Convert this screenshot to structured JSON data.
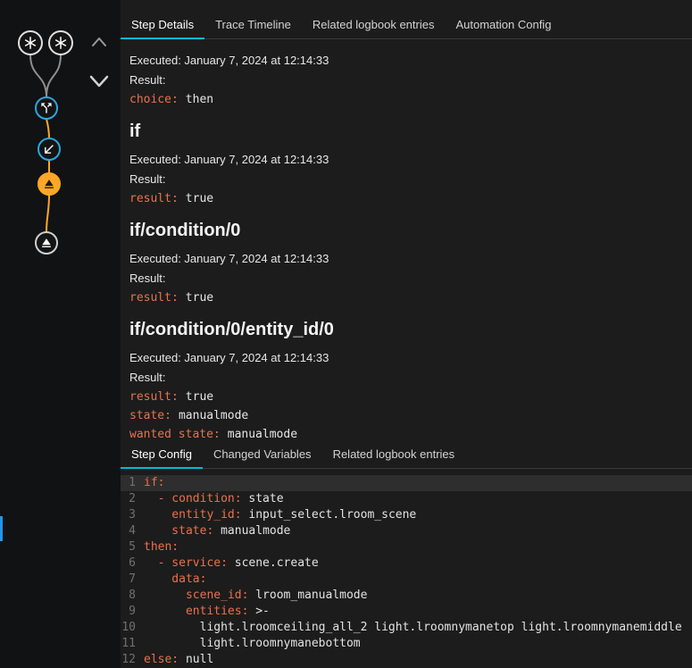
{
  "colors": {
    "tab_accent": "#00bcd4",
    "yaml_key": "#e8724d",
    "node_blue": "#2ba7e0",
    "node_amber": "#ffa726",
    "rail_indicator_blue": "#2196f3"
  },
  "top_tabs": {
    "items": [
      {
        "label": "Step Details",
        "active": true
      },
      {
        "label": "Trace Timeline",
        "active": false
      },
      {
        "label": "Related logbook entries",
        "active": false
      },
      {
        "label": "Automation Config",
        "active": false
      }
    ]
  },
  "sections": [
    {
      "executed": "Executed: January 7, 2024 at 12:14:33",
      "result_label": "Result:",
      "mono": [
        {
          "key": "choice:",
          "value": "then"
        }
      ]
    },
    {
      "heading": "if",
      "executed": "Executed: January 7, 2024 at 12:14:33",
      "result_label": "Result:",
      "mono": [
        {
          "key": "result:",
          "value": "true"
        }
      ]
    },
    {
      "heading": "if/condition/0",
      "executed": "Executed: January 7, 2024 at 12:14:33",
      "result_label": "Result:",
      "mono": [
        {
          "key": "result:",
          "value": "true"
        }
      ]
    },
    {
      "heading": "if/condition/0/entity_id/0",
      "executed": "Executed: January 7, 2024 at 12:14:33",
      "result_label": "Result:",
      "mono": [
        {
          "key": "result:",
          "value": "true"
        },
        {
          "key": "state:",
          "value": "manualmode"
        },
        {
          "key": "wanted_state:",
          "value": "manualmode"
        }
      ]
    }
  ],
  "bottom_tabs": {
    "items": [
      {
        "label": "Step Config",
        "active": true
      },
      {
        "label": "Changed Variables",
        "active": false
      },
      {
        "label": "Related logbook entries",
        "active": false
      }
    ]
  },
  "code": {
    "lines": [
      {
        "num": "1",
        "highlight": true,
        "segments": [
          {
            "t": "if:",
            "c": "k"
          }
        ]
      },
      {
        "num": "2",
        "highlight": false,
        "segments": [
          {
            "t": "  - condition:",
            "c": "k"
          },
          {
            "t": " state",
            "c": "v"
          }
        ]
      },
      {
        "num": "3",
        "highlight": false,
        "segments": [
          {
            "t": "    entity_id:",
            "c": "k"
          },
          {
            "t": " input_select.lroom_scene",
            "c": "v"
          }
        ]
      },
      {
        "num": "4",
        "highlight": false,
        "segments": [
          {
            "t": "    state:",
            "c": "k"
          },
          {
            "t": " manualmode",
            "c": "v"
          }
        ]
      },
      {
        "num": "5",
        "highlight": false,
        "segments": [
          {
            "t": "then:",
            "c": "k"
          }
        ]
      },
      {
        "num": "6",
        "highlight": false,
        "segments": [
          {
            "t": "  - service:",
            "c": "k"
          },
          {
            "t": " scene.create",
            "c": "v"
          }
        ]
      },
      {
        "num": "7",
        "highlight": false,
        "segments": [
          {
            "t": "    data:",
            "c": "k"
          }
        ]
      },
      {
        "num": "8",
        "highlight": false,
        "segments": [
          {
            "t": "      scene_id:",
            "c": "k"
          },
          {
            "t": " lroom_manualmode",
            "c": "v"
          }
        ]
      },
      {
        "num": "9",
        "highlight": false,
        "segments": [
          {
            "t": "      entities:",
            "c": "k"
          },
          {
            "t": " >-",
            "c": "v"
          }
        ]
      },
      {
        "num": "10",
        "highlight": false,
        "segments": [
          {
            "t": "        light.lroomceiling_all_2 light.lroomnymanetop light.lroomnymanemiddle",
            "c": "v"
          }
        ]
      },
      {
        "num": "11",
        "highlight": false,
        "segments": [
          {
            "t": "        light.lroomnymanebottom",
            "c": "v"
          }
        ]
      },
      {
        "num": "12",
        "highlight": false,
        "segments": [
          {
            "t": "else:",
            "c": "k"
          },
          {
            "t": " null",
            "c": "v"
          }
        ]
      }
    ]
  },
  "graph": {
    "nodes": [
      {
        "kind": "trigger",
        "icon": "asterisk-icon",
        "color": "#e0e0e0"
      },
      {
        "kind": "trigger",
        "icon": "asterisk-icon",
        "color": "#e0e0e0"
      },
      {
        "kind": "choose",
        "icon": "call-split-icon",
        "color": "#2ba7e0"
      },
      {
        "kind": "condition",
        "icon": "arrow-bottom-left-icon",
        "color": "#2ba7e0"
      },
      {
        "kind": "action-selected",
        "icon": "eject-icon",
        "color": "#ffa726"
      },
      {
        "kind": "action",
        "icon": "eject-icon",
        "color": "#cfcfcf"
      }
    ],
    "controls": [
      {
        "icon": "chevron-up-icon"
      },
      {
        "icon": "chevron-down-icon"
      }
    ]
  }
}
